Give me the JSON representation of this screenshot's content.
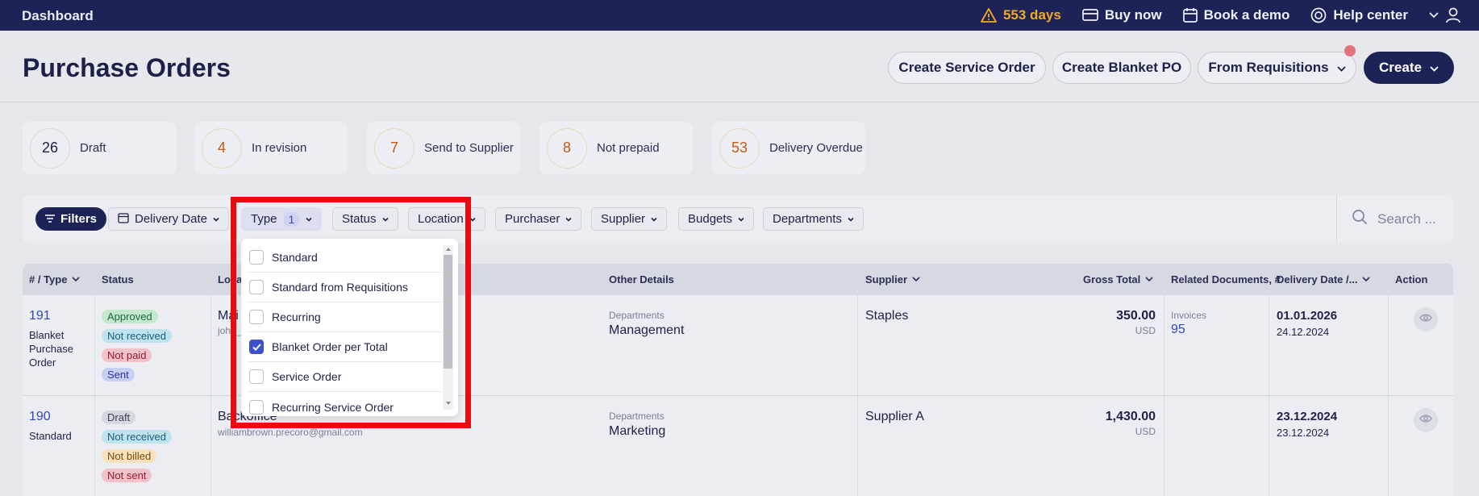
{
  "topbar": {
    "brand": "Dashboard",
    "warning_text": "553 days",
    "buy_now": "Buy now",
    "book_demo": "Book a demo",
    "help_center": "Help center"
  },
  "header": {
    "title": "Purchase Orders",
    "buttons": {
      "create_service_order": "Create Service Order",
      "create_blanket_po": "Create Blanket PO",
      "from_requisitions": "From Requisitions",
      "create": "Create"
    }
  },
  "stats": [
    {
      "count": "26",
      "label": "Draft"
    },
    {
      "count": "4",
      "label": "In revision"
    },
    {
      "count": "7",
      "label": "Send to Supplier"
    },
    {
      "count": "8",
      "label": "Not prepaid"
    },
    {
      "count": "53",
      "label": "Delivery Overdue"
    }
  ],
  "filters": {
    "filters_label": "Filters",
    "delivery_date": "Delivery Date",
    "type": "Type",
    "type_count": "1",
    "status": "Status",
    "location": "Location",
    "purchaser": "Purchaser",
    "supplier": "Supplier",
    "budgets": "Budgets",
    "departments": "Departments",
    "search_placeholder": "Search ..."
  },
  "type_dropdown": {
    "options": [
      {
        "label": "Standard",
        "checked": false
      },
      {
        "label": "Standard from Requisitions",
        "checked": false
      },
      {
        "label": "Recurring",
        "checked": false
      },
      {
        "label": "Blanket Order per Total",
        "checked": true
      },
      {
        "label": "Service Order",
        "checked": false
      },
      {
        "label": "Recurring Service Order",
        "checked": false
      }
    ]
  },
  "table": {
    "headers": {
      "num_type": "# / Type",
      "status": "Status",
      "location": "Loca",
      "other_details": "Other Details",
      "supplier": "Supplier",
      "gross_total": "Gross Total",
      "related_docs": "Related Documents, #",
      "delivery_date": "Delivery Date /...",
      "action": "Action"
    },
    "rows": [
      {
        "number": "191",
        "type_lines": [
          "Blanket",
          "Purchase",
          "Order"
        ],
        "statuses": [
          "Approved",
          "Not received",
          "Not paid",
          "Sent"
        ],
        "location_name": "Mai",
        "location_email": "john_",
        "dept_label": "Departments",
        "dept_value": "Management",
        "supplier": "Staples",
        "total": "350.00",
        "currency": "USD",
        "related_label": "Invoices",
        "related_value": "95",
        "date1": "01.01.2026",
        "date2": "24.12.2024"
      },
      {
        "number": "190",
        "type_lines": [
          "Standard"
        ],
        "statuses": [
          "Draft",
          "Not received",
          "Not billed",
          "Not sent"
        ],
        "location_name": "Backoffice",
        "location_email": "williambrown.precoro@gmail.com",
        "dept_label": "Departments",
        "dept_value": "Marketing",
        "supplier": "Supplier A",
        "total": "1,430.00",
        "currency": "USD",
        "date1": "23.12.2024",
        "date2": "23.12.2024"
      }
    ]
  },
  "colors": {
    "topbar_bg": "#1e2357",
    "warning": "#f2a928",
    "highlight_box": "#ea0b10",
    "checkbox_checked": "#3d52cf"
  }
}
